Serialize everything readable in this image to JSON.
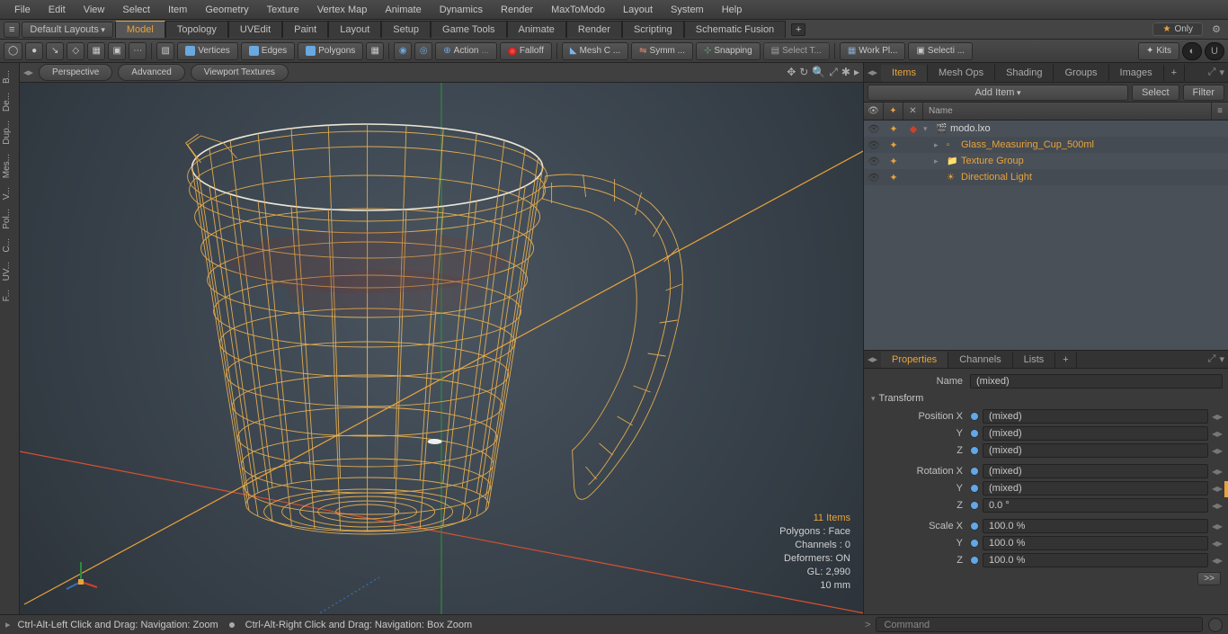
{
  "menu": [
    "File",
    "Edit",
    "View",
    "Select",
    "Item",
    "Geometry",
    "Texture",
    "Vertex Map",
    "Animate",
    "Dynamics",
    "Render",
    "MaxToModo",
    "Layout",
    "System",
    "Help"
  ],
  "layoutbar": {
    "default_layouts": "Default Layouts",
    "only": "Only"
  },
  "layout_tabs": [
    "Model",
    "Topology",
    "UVEdit",
    "Paint",
    "Layout",
    "Setup",
    "Game Tools",
    "Animate",
    "Render",
    "Scripting",
    "Schematic Fusion"
  ],
  "active_layout_tab": "Model",
  "toolbar": {
    "vertices": "Vertices",
    "edges": "Edges",
    "polygons": "Polygons",
    "action": "Action",
    "falloff": "Falloff",
    "meshc": "Mesh C ...",
    "symm": "Symm ...",
    "snapping": "Snapping",
    "selectt": "Select T...",
    "workpl": "Work Pl...",
    "selecti": "Selecti ...",
    "kits": "Kits"
  },
  "viewport_tabs": [
    "Perspective",
    "Advanced",
    "Viewport Textures"
  ],
  "hud": {
    "items": "11 Items",
    "polys": "Polygons : Face",
    "channels": "Channels : 0",
    "deformers": "Deformers: ON",
    "gl": "GL: 2,990",
    "mm": "10 mm"
  },
  "leftstrip": [
    "B...",
    "De...",
    "Dup...",
    "Mes...",
    "V...",
    "Pol...",
    "C...",
    "UV...",
    "F..."
  ],
  "rp": {
    "tabs": [
      "Items",
      "Mesh Ops",
      "Shading",
      "Groups",
      "Images"
    ],
    "add_item": "Add Item",
    "select": "Select",
    "filter": "Filter",
    "name_col": "Name"
  },
  "tree": [
    {
      "name": "modo.lxo",
      "indent": 0,
      "white": true,
      "icon": "🎬",
      "d": "▾",
      "eye": true,
      "plus": true,
      "dot": true
    },
    {
      "name": "Glass_Measuring_Cup_500ml",
      "indent": 1,
      "icon": "▫",
      "d": "▸",
      "eye": true,
      "plus": true
    },
    {
      "name": "Texture Group",
      "indent": 1,
      "icon": "📁",
      "d": "▸",
      "eye": true,
      "plus": true
    },
    {
      "name": "Directional Light",
      "indent": 1,
      "icon": "☀",
      "d": "",
      "eye": true,
      "plus": true
    }
  ],
  "props": {
    "tabs": [
      "Properties",
      "Channels",
      "Lists"
    ],
    "name_label": "Name",
    "name_value": "(mixed)",
    "transform_section": "Transform",
    "rows": [
      {
        "label": "Position X",
        "value": "(mixed)"
      },
      {
        "label": "Y",
        "value": "(mixed)"
      },
      {
        "label": "Z",
        "value": "(mixed)"
      },
      {
        "label": "Rotation X",
        "value": "(mixed)"
      },
      {
        "label": "Y",
        "value": "(mixed)"
      },
      {
        "label": "Z",
        "value": "0.0 °"
      },
      {
        "label": "Scale X",
        "value": "100.0 %"
      },
      {
        "label": "Y",
        "value": "100.0 %"
      },
      {
        "label": "Z",
        "value": "100.0 %"
      }
    ],
    "nav": ">>"
  },
  "status": {
    "hint1": "Ctrl-Alt-Left Click and Drag: Navigation: Zoom",
    "hint2": "Ctrl-Alt-Right Click and Drag: Navigation: Box Zoom",
    "cmd_placeholder": "Command",
    "prompt": ">"
  }
}
